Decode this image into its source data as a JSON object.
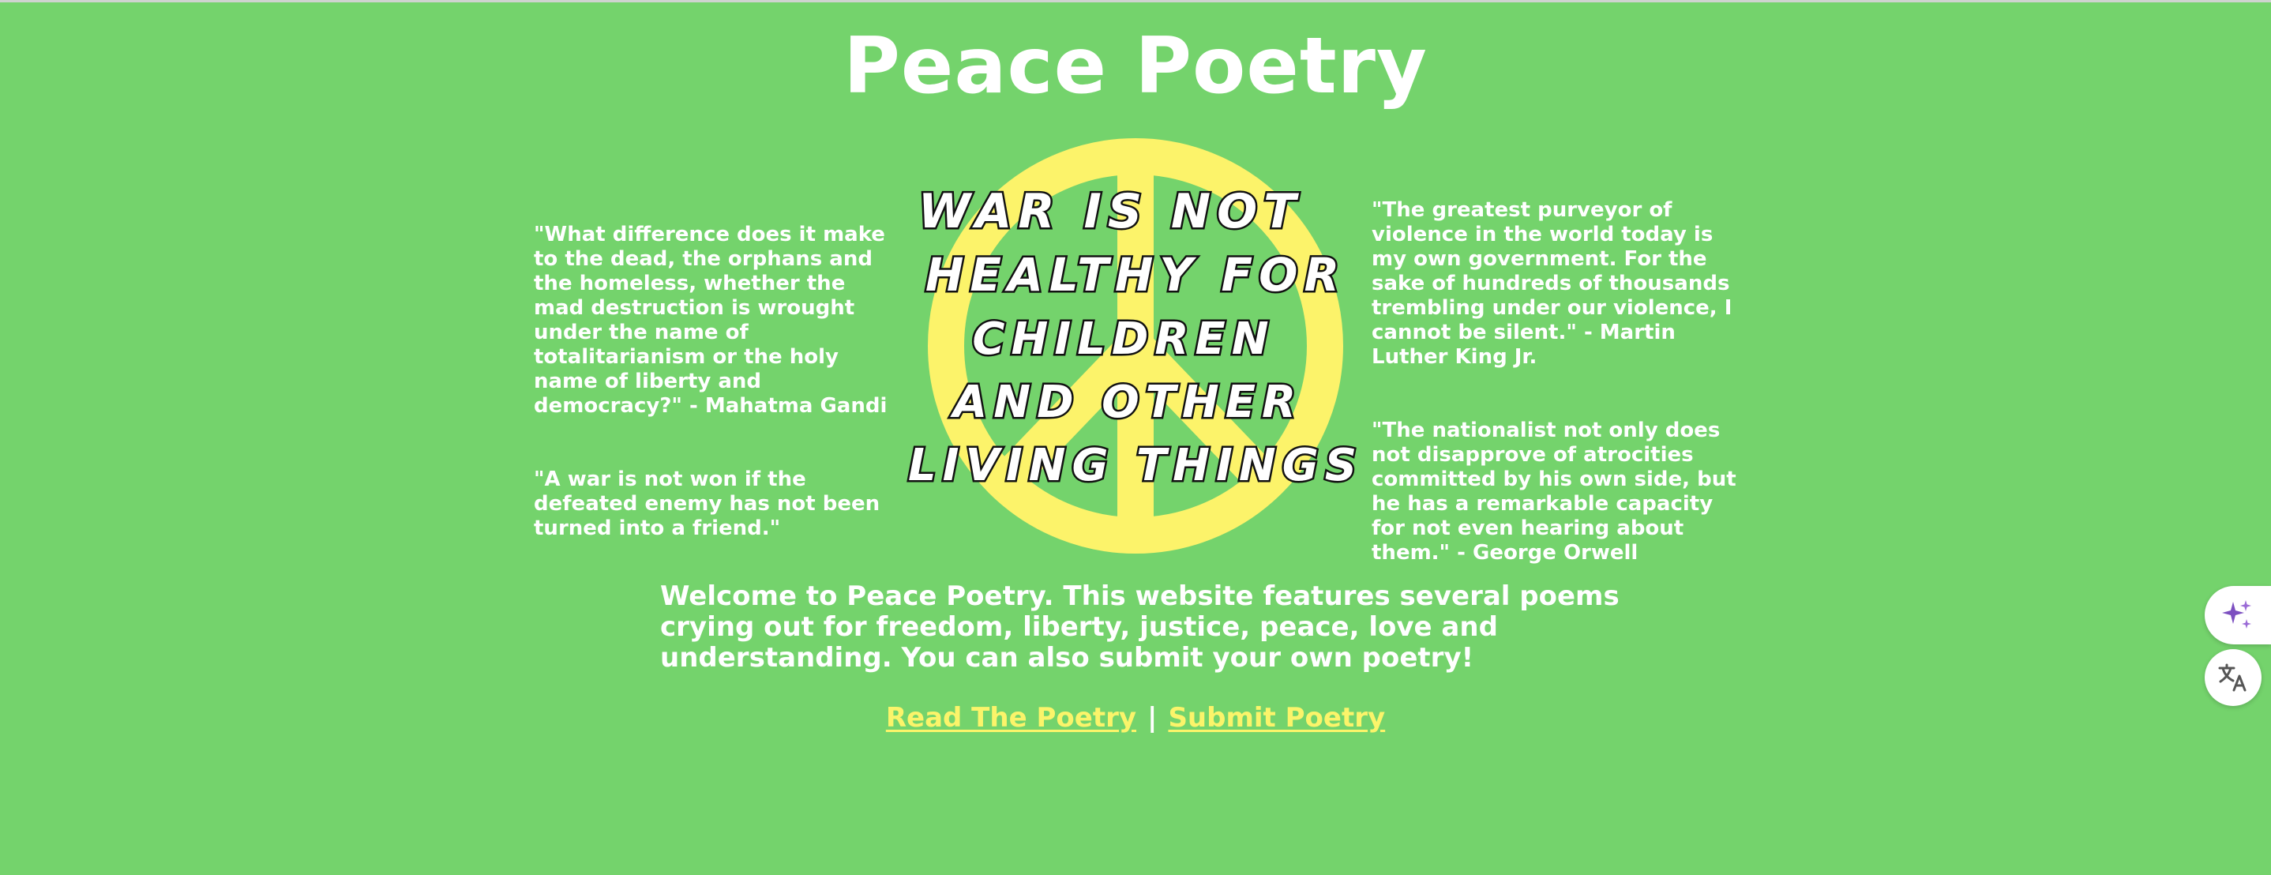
{
  "page": {
    "title": "Peace Poetry"
  },
  "quotes_left": [
    {
      "text": "\"What difference does it make to the dead, the orphans and the homeless, whether the mad destruction is wrought under the name of totalitarianism or the holy name of liberty and democracy?\" - Mahatma Gandi"
    },
    {
      "text": "\"A war is not won if the defeated enemy has not been turned into a friend.\""
    }
  ],
  "quotes_right": [
    {
      "text": "\"The greatest purveyor of violence in the world today is my own government. For the sake of hundreds of thousands trembling under our violence, I cannot be silent.\" - Martin Luther King Jr."
    },
    {
      "text": "\"The nationalist not only does not disapprove of atrocities committed by his own side, but he has a remarkable capacity for not even hearing about them.\" - George Orwell"
    }
  ],
  "graphic": {
    "lines": [
      "WAR IS NOT",
      "HEALTHY FOR",
      "CHILDREN",
      "AND OTHER",
      "LIVING THINGS"
    ],
    "icon": "peace-sign-icon",
    "fill_color": "#fcf36a"
  },
  "welcome": {
    "text": "Welcome to Peace Poetry. This website features several poems crying out for freedom, liberty, justice, peace, love and understanding. You can also submit your own poetry!"
  },
  "nav": {
    "read_label": "Read The Poetry",
    "separator": "|",
    "submit_label": "Submit Poetry"
  },
  "side_tools": {
    "ai_icon": "sparkle-icon",
    "translate_icon": "translate-icon"
  },
  "colors": {
    "background": "#74d36c",
    "link": "#fbf46a",
    "text": "#ffffff"
  }
}
